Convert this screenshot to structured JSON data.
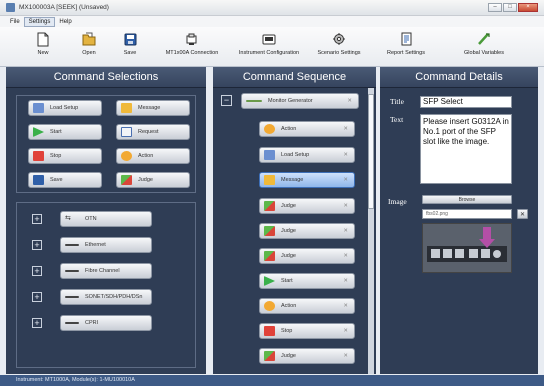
{
  "window": {
    "title": "MX100003A [SEEK] (Unsaved)"
  },
  "menu": {
    "items": [
      "File",
      "Settings",
      "Help"
    ]
  },
  "toolbar": {
    "new": "New",
    "open": "Open",
    "save": "Save",
    "mt_connection": "MT1x00A Connection",
    "instrument_configuration": "Instrument Configuration",
    "scenario_settings": "Scenario Settings",
    "report_settings": "Report Settings",
    "global_variables": "Global Variables"
  },
  "command_selections": {
    "title": "Command Selections",
    "buttons": [
      "Load Setup",
      "Message",
      "Start",
      "Request",
      "Stop",
      "Action",
      "Save",
      "Judge"
    ],
    "groups": [
      "OTN",
      "Ethernet",
      "Fibre Channel",
      "SONET/SDH/PDH/DSn",
      "CPRI"
    ]
  },
  "command_sequence": {
    "title": "Command Sequence",
    "root": "Monitor Generator",
    "items": [
      "Action",
      "Load Setup",
      "Message",
      "Judge",
      "Judge",
      "Judge",
      "Start",
      "Action",
      "Stop",
      "Judge"
    ],
    "selected_index": 2
  },
  "command_details": {
    "title": "Command Details",
    "title_label": "Title",
    "title_value": "SFP Select",
    "text_label": "Text",
    "text_value": "Please insert G0312A in No.1 port of the SFP slot like the image.",
    "image_label": "Image",
    "browse": "Browse",
    "image_file": "fbs02.png"
  },
  "status": {
    "text": "Instrument: MT1000A, Module(s): 1-MU100010A"
  }
}
